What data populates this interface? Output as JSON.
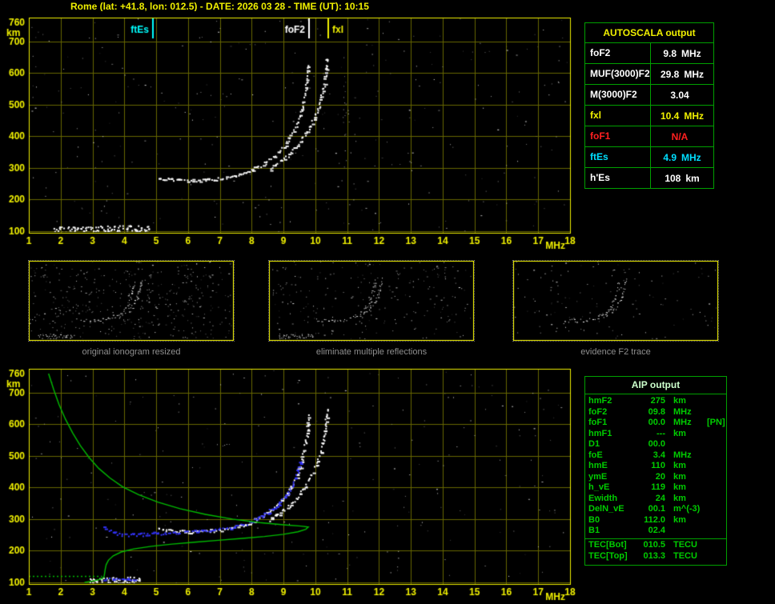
{
  "window": {
    "title": "Rome (lat: +41.8, lon: 012.5) - DATE: 2026 03 28 - TIME (UT): 10:15"
  },
  "colors": {
    "background": "#000000",
    "axis": "#f0f000",
    "grid": "#666600",
    "trace": "#ffffff",
    "profile": "#00bb00",
    "restored_trace": "#3333ff",
    "table_border": "#00a000",
    "autoscala_header": "#f0f000",
    "aip_text": "#00cc00",
    "caption": "#8f8f8f",
    "marker_ftes": "#00ffff",
    "marker_fof2": "#ffffff",
    "marker_fxl": "#f0f000"
  },
  "autoscala": {
    "header": "AUTOSCALA output",
    "rows": [
      {
        "label": "foF2",
        "value": "9.8",
        "unit": "MHz",
        "color": "#ffffff"
      },
      {
        "label": "MUF(3000)F2",
        "value": "29.8",
        "unit": "MHz",
        "color": "#ffffff"
      },
      {
        "label": "M(3000)F2",
        "value": "3.04",
        "unit": "",
        "color": "#ffffff"
      },
      {
        "label": "fxl",
        "value": "10.4",
        "unit": "MHz",
        "color": "#f0f000"
      },
      {
        "label": "foF1",
        "value": "N/A",
        "unit": "",
        "color": "#ff2020"
      },
      {
        "label": "ftEs",
        "value": "4.9",
        "unit": "MHz",
        "color": "#00dfff"
      },
      {
        "label": "h'Es",
        "value": "108",
        "unit": "km",
        "color": "#ffffff"
      }
    ]
  },
  "aip": {
    "header": "AIP output",
    "rows": [
      {
        "label": "hmF2",
        "value": "275",
        "unit": "km",
        "note": ""
      },
      {
        "label": "foF2",
        "value": "09.8",
        "unit": "MHz",
        "note": ""
      },
      {
        "label": "foF1",
        "value": "00.0",
        "unit": "MHz",
        "note": "[PN]"
      },
      {
        "label": "hmF1",
        "value": "---",
        "unit": "km",
        "note": ""
      },
      {
        "label": "D1",
        "value": "00.0",
        "unit": "",
        "note": ""
      },
      {
        "label": "foE",
        "value": "3.4",
        "unit": "MHz",
        "note": ""
      },
      {
        "label": "hmE",
        "value": "110",
        "unit": "km",
        "note": ""
      },
      {
        "label": "ymE",
        "value": "20",
        "unit": "km",
        "note": ""
      },
      {
        "label": "h_vE",
        "value": "119",
        "unit": "km",
        "note": ""
      },
      {
        "label": "Ewidth",
        "value": "24",
        "unit": "km",
        "note": ""
      },
      {
        "label": "DelN_vE",
        "value": "00.1",
        "unit": "m^(-3)",
        "note": ""
      },
      {
        "label": "B0",
        "value": "112.0",
        "unit": "km",
        "note": ""
      },
      {
        "label": "B1",
        "value": "02.4",
        "unit": "",
        "note": ""
      }
    ],
    "tec_rows": [
      {
        "label": "TEC[Bot]",
        "value": "010.5",
        "unit": "TECU"
      },
      {
        "label": "TEC[Top]",
        "value": "013.3",
        "unit": "TECU"
      }
    ]
  },
  "thumbnails": [
    {
      "caption": "original ionogram resized",
      "series": [
        "es",
        "f2o",
        "f2x",
        "hop",
        "spread"
      ],
      "noise": 420
    },
    {
      "caption": "eliminate multiple reflections",
      "series": [
        "es",
        "f2o",
        "f2x"
      ],
      "noise": 240
    },
    {
      "caption": "evidence F2 trace",
      "series": [
        "f2o",
        "f2x"
      ],
      "noise": 130
    }
  ],
  "chart_data": [
    {
      "id": "top_ionogram",
      "type": "scatter",
      "title": "",
      "xlabel": "MHz",
      "ylabel": "km",
      "xlim": [
        1,
        18
      ],
      "ylim": [
        100,
        760
      ],
      "xticks": [
        1,
        2,
        3,
        4,
        5,
        6,
        7,
        8,
        9,
        10,
        11,
        12,
        13,
        14,
        15,
        16,
        17,
        18
      ],
      "yticks": [
        760,
        700,
        600,
        500,
        400,
        300,
        200,
        100
      ],
      "grid": true,
      "legend": "none",
      "noise": 320,
      "markers": [
        {
          "label": "ftEs",
          "freq": 4.9,
          "color": "#00ffff",
          "side": "left"
        },
        {
          "label": "foF2",
          "freq": 9.8,
          "color": "#ffffff",
          "side": "left"
        },
        {
          "label": "fxl",
          "freq": 10.4,
          "color": "#f0f000",
          "side": "right"
        }
      ],
      "series": [
        {
          "name": "es",
          "label": "Es layer trace (h'Es 108 km)",
          "style": "blob",
          "color": "#ffffff",
          "points": [
            [
              1.8,
              104
            ],
            [
              2.3,
              105
            ],
            [
              2.8,
              106
            ],
            [
              3.3,
              107
            ],
            [
              3.8,
              108
            ],
            [
              4.3,
              108
            ],
            [
              4.8,
              108
            ]
          ]
        },
        {
          "name": "f2o",
          "label": "F2 ordinary trace (foF2 9.8 MHz)",
          "style": "trace",
          "color": "#ffffff",
          "points": [
            [
              5.05,
              270
            ],
            [
              5.5,
              264
            ],
            [
              6.0,
              261
            ],
            [
              6.5,
              262
            ],
            [
              7.0,
              267
            ],
            [
              7.5,
              277
            ],
            [
              7.95,
              292
            ],
            [
              8.35,
              312
            ],
            [
              8.7,
              338
            ],
            [
              9.0,
              370
            ],
            [
              9.25,
              407
            ],
            [
              9.45,
              450
            ],
            [
              9.58,
              495
            ],
            [
              9.68,
              540
            ],
            [
              9.74,
              588
            ],
            [
              9.78,
              635
            ]
          ]
        },
        {
          "name": "f2x",
          "label": "F2 extraordinary trace (fxl 10.4 MHz)",
          "style": "trace",
          "color": "#ffffff",
          "points": [
            [
              8.55,
              298
            ],
            [
              8.9,
              322
            ],
            [
              9.25,
              352
            ],
            [
              9.55,
              388
            ],
            [
              9.8,
              428
            ],
            [
              10.0,
              470
            ],
            [
              10.15,
              515
            ],
            [
              10.25,
              560
            ],
            [
              10.32,
              608
            ],
            [
              10.36,
              652
            ]
          ]
        },
        {
          "name": "hop",
          "label": "second hop echoes",
          "style": "sparse",
          "color": "#c8c8c8",
          "points": [
            [
              6.3,
              540
            ],
            [
              6.7,
              532
            ],
            [
              7.1,
              530
            ],
            [
              7.5,
              538
            ]
          ]
        },
        {
          "name": "spread",
          "label": "spread echoes",
          "style": "sparse",
          "color": "#d0d0d0",
          "points": [
            [
              10.95,
              300
            ],
            [
              10.9,
              450
            ],
            [
              10.95,
              620
            ]
          ]
        }
      ]
    },
    {
      "id": "bottom_ionogram_with_profile",
      "type": "scatter",
      "title": "",
      "xlabel": "MHz",
      "ylabel": "km",
      "xlim": [
        1,
        18
      ],
      "ylim": [
        100,
        760
      ],
      "xticks": [
        1,
        2,
        3,
        4,
        5,
        6,
        7,
        8,
        9,
        10,
        11,
        12,
        13,
        14,
        15,
        16,
        17,
        18
      ],
      "yticks": [
        760,
        700,
        600,
        500,
        400,
        300,
        200,
        100
      ],
      "grid": true,
      "legend": "none",
      "noise": 260,
      "series": [
        {
          "name": "es",
          "label": "Es layer trace",
          "style": "blob",
          "color": "#ffffff",
          "points": [
            [
              2.9,
              104
            ],
            [
              3.3,
              105
            ],
            [
              3.7,
              106
            ],
            [
              4.1,
              107
            ],
            [
              4.5,
              108
            ]
          ]
        },
        {
          "name": "f2o",
          "label": "F2 ordinary trace",
          "style": "trace",
          "color": "#ffffff",
          "points": [
            [
              5.05,
              270
            ],
            [
              5.5,
              264
            ],
            [
              6.0,
              261
            ],
            [
              6.5,
              262
            ],
            [
              7.0,
              267
            ],
            [
              7.5,
              277
            ],
            [
              7.95,
              292
            ],
            [
              8.35,
              312
            ],
            [
              8.7,
              338
            ],
            [
              9.0,
              370
            ],
            [
              9.25,
              407
            ],
            [
              9.45,
              450
            ],
            [
              9.58,
              495
            ],
            [
              9.68,
              540
            ],
            [
              9.74,
              588
            ],
            [
              9.78,
              635
            ]
          ]
        },
        {
          "name": "f2x",
          "label": "F2 extraordinary trace",
          "style": "trace",
          "color": "#ffffff",
          "points": [
            [
              8.55,
              298
            ],
            [
              8.9,
              322
            ],
            [
              9.25,
              352
            ],
            [
              9.55,
              388
            ],
            [
              9.8,
              428
            ],
            [
              10.0,
              470
            ],
            [
              10.15,
              515
            ],
            [
              10.25,
              560
            ],
            [
              10.32,
              608
            ],
            [
              10.36,
              652
            ]
          ]
        },
        {
          "name": "hop",
          "label": "second hop echoes",
          "style": "sparse",
          "color": "#c8c8c8",
          "points": [
            [
              6.3,
              540
            ],
            [
              6.9,
              532
            ],
            [
              7.4,
              538
            ]
          ]
        },
        {
          "name": "restored",
          "label": "autoscala restored trace",
          "style": "trace",
          "color": "#3333ff",
          "points": [
            [
              3.35,
              278
            ],
            [
              3.5,
              266
            ],
            [
              3.7,
              257
            ],
            [
              4.0,
              252
            ],
            [
              4.4,
              252
            ],
            [
              4.9,
              256
            ],
            [
              5.4,
              258
            ],
            [
              5.9,
              260
            ],
            [
              6.4,
              263
            ],
            [
              6.9,
              267
            ],
            [
              7.4,
              275
            ],
            [
              7.9,
              290
            ],
            [
              8.3,
              310
            ],
            [
              8.7,
              337
            ],
            [
              9.0,
              368
            ],
            [
              9.25,
              405
            ],
            [
              9.42,
              448
            ],
            [
              9.53,
              492
            ]
          ]
        },
        {
          "name": "restored-es",
          "label": "restored Es trace",
          "style": "trace",
          "color": "#3333ff",
          "points": [
            [
              3.2,
              110
            ],
            [
              3.6,
              111
            ],
            [
              4.0,
              112
            ],
            [
              4.4,
              112
            ]
          ]
        }
      ],
      "profile": {
        "label": "electron density profile (hmF2 275 km, foF2 9.8 MHz, foE 3.4 MHz)",
        "color": "#00bb00",
        "solid": [
          [
            1.62,
            760
          ],
          [
            1.78,
            710
          ],
          [
            1.95,
            662
          ],
          [
            2.15,
            616
          ],
          [
            2.38,
            572
          ],
          [
            2.62,
            532
          ],
          [
            2.9,
            494
          ],
          [
            3.2,
            460
          ],
          [
            3.55,
            430
          ],
          [
            3.95,
            402
          ],
          [
            4.45,
            377
          ],
          [
            5.05,
            354
          ],
          [
            5.75,
            333
          ],
          [
            6.55,
            315
          ],
          [
            7.4,
            300
          ],
          [
            8.25,
            289
          ],
          [
            9.0,
            282
          ],
          [
            9.55,
            278
          ],
          [
            9.78,
            275
          ],
          [
            9.7,
            268
          ],
          [
            9.45,
            260
          ],
          [
            9.0,
            252
          ],
          [
            8.4,
            245
          ],
          [
            7.7,
            239
          ],
          [
            6.95,
            233
          ],
          [
            6.2,
            227
          ],
          [
            5.5,
            221
          ],
          [
            4.85,
            214
          ],
          [
            4.3,
            206
          ],
          [
            3.9,
            196
          ],
          [
            3.65,
            184
          ],
          [
            3.5,
            170
          ],
          [
            3.43,
            156
          ],
          [
            3.4,
            142
          ],
          [
            3.38,
            128
          ],
          [
            3.36,
            117
          ],
          [
            3.25,
            110
          ],
          [
            3.0,
            104
          ],
          [
            2.75,
            100
          ]
        ],
        "dotted": [
          [
            1.0,
            119
          ],
          [
            3.3,
            119
          ]
        ]
      }
    }
  ]
}
